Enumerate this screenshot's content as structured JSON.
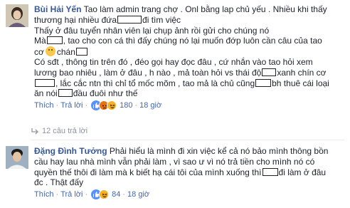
{
  "comment1": {
    "author": "Bùi Hải Yến",
    "lines": [
      [
        "Tao làm admin trang chợ . Onl bằng lap chủ yếu . Nhiều khi thấy"
      ],
      [
        "thương hại nhiều đứa",
        "đi tìm việc"
      ],
      [
        "Thấy ở đâu tuyển nhân viên lại chụp ảnh rồi gửi cho chúng nó"
      ],
      [
        "Mà",
        ", tao cho con cá thì đấy chúng nó lại muốn đớp luôn cần câu của tao"
      ],
      [
        "cơ",
        "chán"
      ],
      [
        "Có sđt , thông tin trên đó , đéo gọi hay đọc đâu , cứ nhắn vào tao hỏi xem"
      ],
      [
        "lương bao nhiêu , làm ở đâu , h nào , mả toàn hỏi vs thái độ",
        "xanh chín cơ"
      ],
      [
        ", lắc cắc ntn thì chỉ tổ mốc mõm , tao mả là chủ cũng",
        "bh thuê cái loại"
      ],
      [
        "ăn nói",
        "đầu đuôi như thế"
      ]
    ],
    "actions": {
      "like": "Thích",
      "reply": "Trả lời",
      "reaction_count": "180",
      "time": "18 giờ"
    },
    "replies_label": "12 câu trả lời"
  },
  "comment2": {
    "author": "Đặng Đình Tưởng",
    "lines": [
      [
        "Phải hiểu là mình đi xin việc kể cả nó bảo mình thông bồn"
      ],
      [
        "cầu hay lau nhà mình vẫn phải làm , vì sao ư vì nó trả tiền cho mình nó có"
      ],
      [
        "quyền thế thôi đi làm mà k biết hạ cái tôi của mình xuống thì",
        "đi làm ở đâu"
      ],
      [
        "đc . Thật đấy"
      ]
    ],
    "actions": {
      "like": "Thích",
      "reply": "Trả lời",
      "reaction_count": "84",
      "time": "18 giờ"
    }
  },
  "colors": {
    "author": "#365899",
    "link": "#4267b2",
    "meta": "#90949c",
    "text": "#1d2129"
  },
  "icons": [
    "like-reaction-icon",
    "angry-reaction-icon",
    "haha-reaction-icon",
    "reply-arrow-icon",
    "grinning-emoji-icon"
  ]
}
